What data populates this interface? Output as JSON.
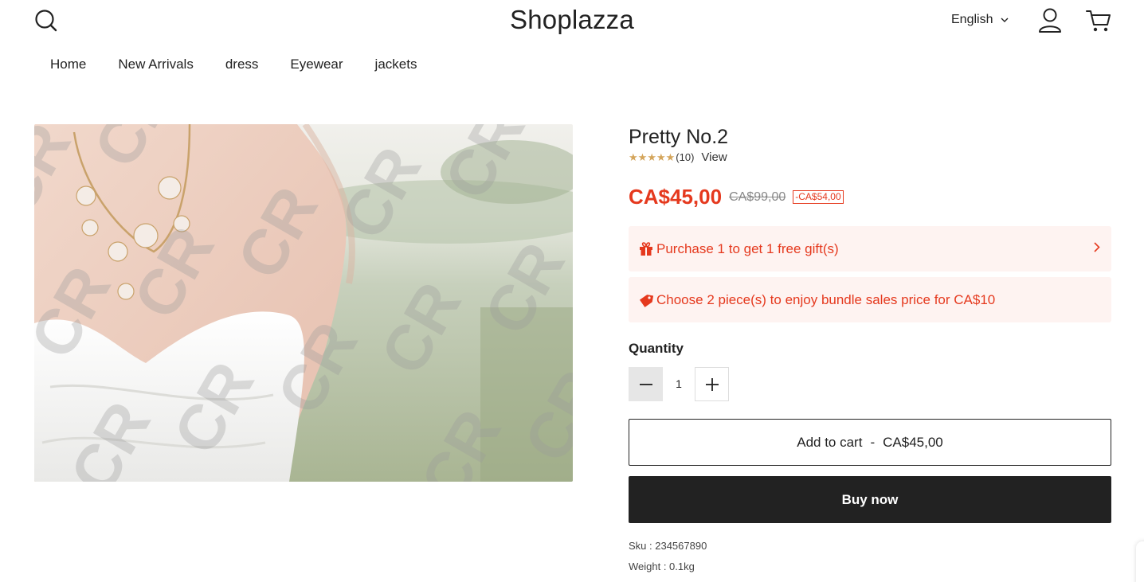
{
  "header": {
    "logo": "Shoplazza",
    "language": "English",
    "icons": {
      "search": "search-icon",
      "account": "user-icon",
      "cart": "cart-icon",
      "language_chevron": "chevron-down-icon"
    }
  },
  "nav": {
    "items": [
      {
        "label": "Home"
      },
      {
        "label": "New Arrivals"
      },
      {
        "label": "dress"
      },
      {
        "label": "Eyewear"
      },
      {
        "label": "jackets"
      }
    ]
  },
  "product": {
    "image_watermark": "CR",
    "title": "Pretty No.2",
    "rating": {
      "stars": 5,
      "count": "(10)",
      "view_label": "View"
    },
    "price": "CA$45,00",
    "compare_price": "CA$99,00",
    "discount": "-CA$54,00",
    "promotions": [
      {
        "icon": "gift-icon",
        "text": "Purchase 1 to get 1 free gift(s)"
      },
      {
        "icon": "tag-icon",
        "text": "Choose 2 piece(s) to enjoy bundle sales price for CA$10"
      }
    ],
    "quantity": {
      "label": "Quantity",
      "value": "1"
    },
    "add_to_cart": {
      "label": "Add to cart",
      "separator": "-",
      "price": "CA$45,00"
    },
    "buy_now": "Buy now",
    "sku": "Sku : 234567890",
    "weight": "Weight : 0.1kg"
  },
  "colors": {
    "accent": "#e5391e",
    "promo_bg": "#fef3f1",
    "star": "#d4a55b",
    "button_dark": "#222222"
  }
}
